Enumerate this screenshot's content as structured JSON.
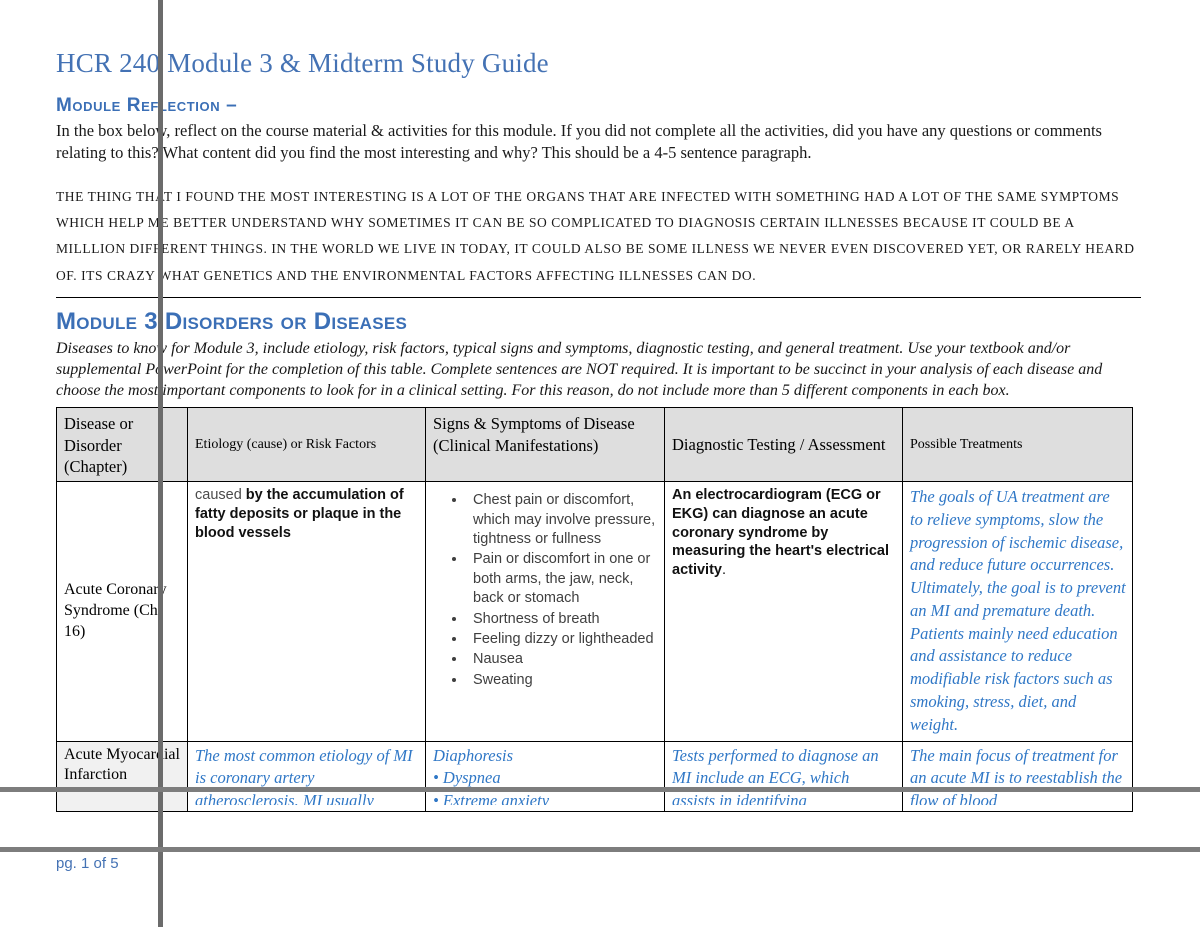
{
  "document": {
    "title": "HCR 240 Module 3 & Midterm Study Guide",
    "page_label": "pg. 1 of 5"
  },
  "reflection": {
    "heading": "Module Reflection –",
    "instructions": "In the box below, reflect on the course material & activities for this module.  If you did not complete all the activities, did you have any questions or comments relating to this?  What content did you find the most interesting and why?  This should be a 4-5 sentence paragraph.",
    "response": "The thing that I found the most interesting is a lot of the organs that are infected with something had a lot of the same symptoms which help me better understand why sometimes it can be so complicated to diagnosis certain illnesses because it could be a milllion different things. In the world we live in today, it could also be some illness we never even discovered yet, or rarely heard of. Its crazy what genetics and the environmental factors affecting illnesses can do."
  },
  "module3": {
    "heading": "Module 3 Disorders or Diseases",
    "instructions": "Diseases to know for Module 3, include etiology, risk factors, typical signs and symptoms, diagnostic testing, and general treatment.  Use your textbook and/or supplemental PowerPoint for the completion of this table.  Complete sentences are NOT required.  It is important to be succinct in your analysis of each disease and choose the most important components to look for in a clinical setting. For this reason, do not include more than 5 different components in each box."
  },
  "table": {
    "headers": {
      "col1": "Disease or Disorder (Chapter)",
      "col2": "Etiology (cause) or Risk Factors",
      "col3": "Signs & Symptoms of Disease (Clinical Manifestations)",
      "col4": "Diagnostic Testing / Assessment",
      "col5": "Possible Treatments"
    },
    "rows": [
      {
        "disease": "Acute Coronary Syndrome (Ch. 16)",
        "etiology_lead": "caused",
        "etiology_bold": "by the accumulation of fatty deposits or plaque in the blood vessels",
        "signs": [
          "Chest pain or discomfort, which may involve pressure, tightness or fullness",
          "Pain or discomfort in one or both arms, the jaw, neck, back or stomach",
          "Shortness of breath",
          "Feeling dizzy or lightheaded",
          "Nausea",
          "Sweating"
        ],
        "diagnostic_bold": "An electrocardiogram (ECG or EKG) can diagnose an acute coronary syndrome by measuring the heart's electrical activity",
        "diagnostic_tail": ".",
        "treatment": "The goals of UA treatment are to relieve symptoms, slow the progression of ischemic disease, and reduce future occurrences. Ultimately, the goal is to prevent an MI and premature death. Patients mainly need education and assistance to reduce modifiable risk factors such as smoking, stress, diet, and weight."
      },
      {
        "disease": "Acute Myocardial Infarction",
        "etiology": "The most common etiology of MI is coronary artery atherosclerosis. MI usually",
        "signs": "Diaphoresis\n• Dyspnea\n• Extreme anxiety",
        "diagnostic": "Tests performed to diagnose an MI include an ECG, which assists in identifying",
        "treatment": "The main focus of treatment for an acute MI is to reestablish the flow of blood"
      }
    ]
  },
  "colors": {
    "heading_blue": "#3b6fb6",
    "title_blue": "#4472b4",
    "student_text_blue": "#2f77c6",
    "header_row_bg": "#dedede",
    "shaded_cell_bg": "#f1f1f1",
    "guide_line": "#6b6b6b"
  }
}
